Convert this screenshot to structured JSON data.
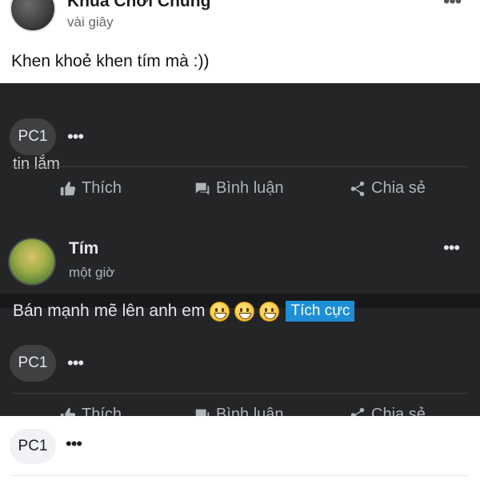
{
  "top_post": {
    "author": "Khùa Chơi Chung",
    "time": "vài giây",
    "menu": "•••",
    "text": "Khen khoẻ khen tím mà :))"
  },
  "first_card": {
    "cut_text": "tin lắm",
    "commenter": "PC1",
    "more": "•••",
    "actions": {
      "like": "Thích",
      "comment": "Bình luận",
      "share": "Chia sẻ"
    }
  },
  "tim_post": {
    "author": "Tím",
    "time": "một giờ",
    "menu": "•••",
    "text": "Bán mạnh mẽ lên anh em",
    "emojis": [
      "grinning-face",
      "grinning-face",
      "grinning-face"
    ],
    "tag": "Tích cực",
    "commenter": "PC1",
    "more": "•••",
    "actions": {
      "like": "Thích",
      "comment": "Bình luận",
      "share": "Chia sẻ"
    }
  },
  "bottom": {
    "commenter": "PC1",
    "more": "•••"
  },
  "colors": {
    "dark_bg": "#242526",
    "separator": "#18191a",
    "tag_bg": "#1e8fd6"
  }
}
